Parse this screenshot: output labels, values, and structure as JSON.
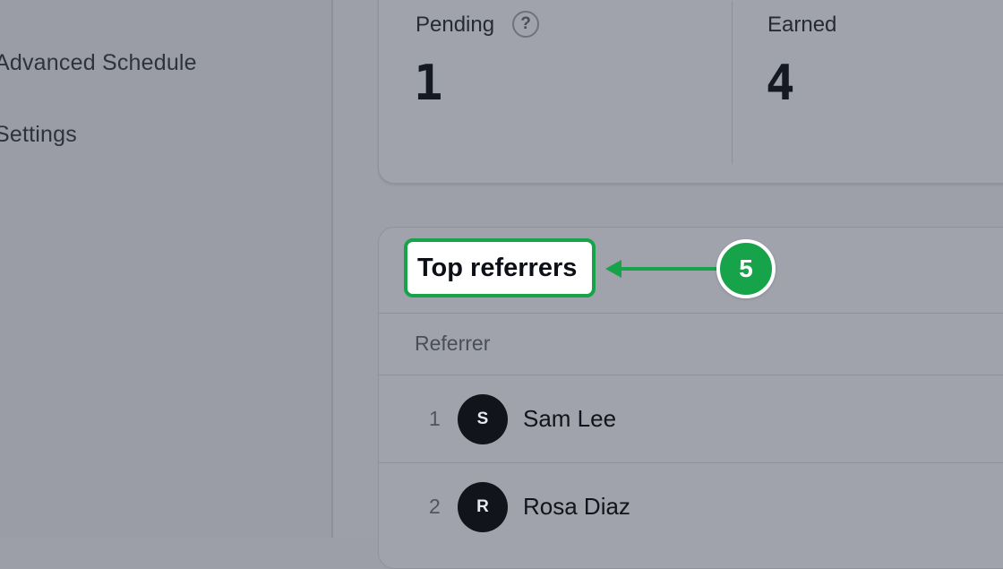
{
  "sidebar": {
    "items": [
      {
        "label": "Advanced Schedule"
      },
      {
        "label": "Settings"
      }
    ]
  },
  "stats": {
    "pending": {
      "label": "Pending",
      "value": "1",
      "help_glyph": "?"
    },
    "earned": {
      "label": "Earned",
      "value": "4"
    }
  },
  "top_referrers": {
    "title": "Top referrers",
    "column_header": "Referrer",
    "rows": [
      {
        "rank": "1",
        "initial": "S",
        "name": "Sam Lee"
      },
      {
        "rank": "2",
        "initial": "R",
        "name": "Rosa Diaz"
      }
    ]
  },
  "annotation": {
    "step_number": "5",
    "color": "#17a34a"
  },
  "icons": [
    "help-icon",
    "arrow-left-icon"
  ]
}
